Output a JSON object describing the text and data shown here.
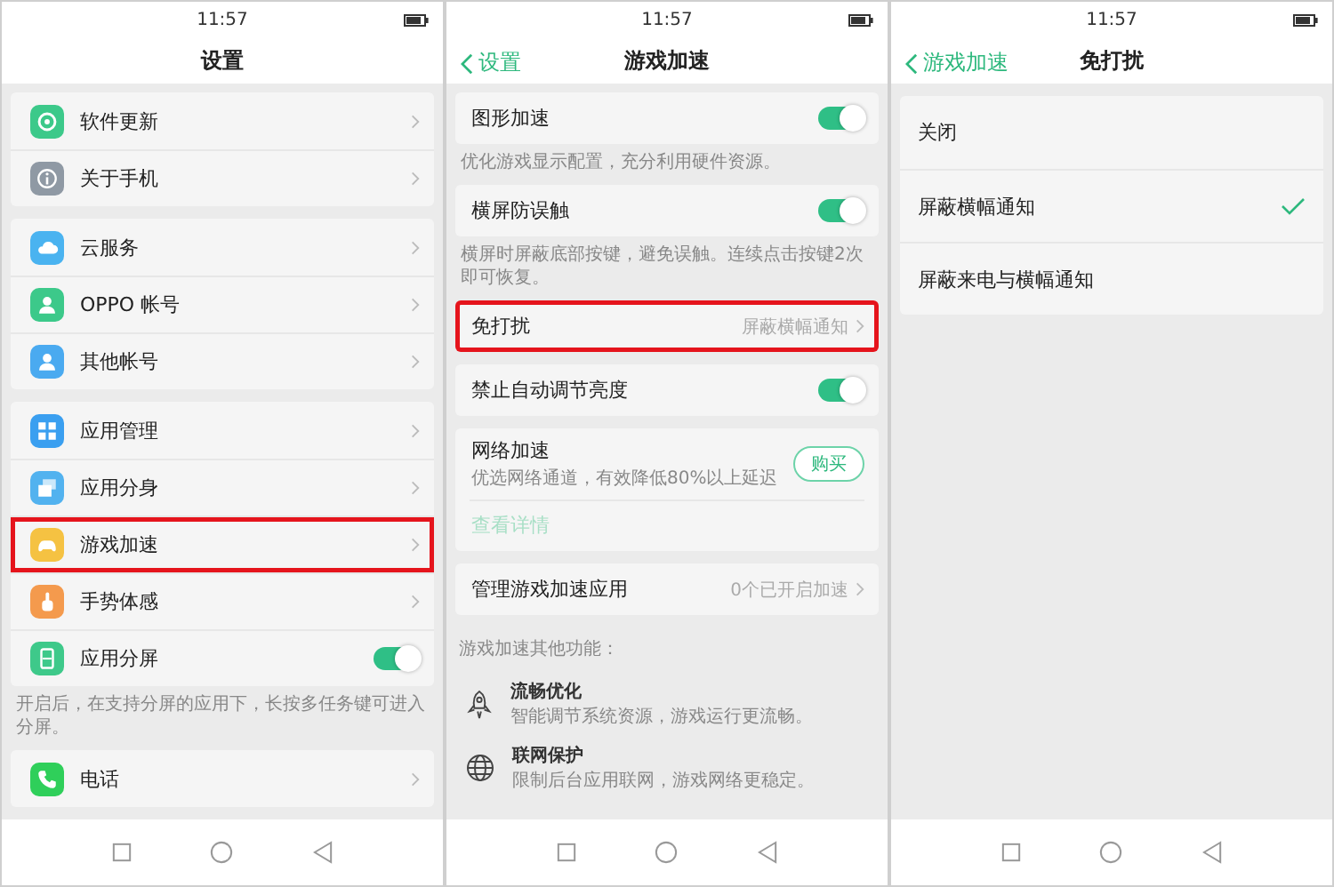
{
  "settings_screen": {
    "time": "11:57",
    "title": "设置",
    "groups": [
      {
        "items": [
          {
            "kind": "link",
            "label": "软件更新",
            "color": "#3cc98a",
            "highlighted": false
          },
          {
            "kind": "link",
            "label": "关于手机",
            "color": "#8f99a4",
            "highlighted": false
          }
        ]
      },
      {
        "items": [
          {
            "kind": "link",
            "label": "云服务",
            "color": "#4ab3f0",
            "highlighted": false
          },
          {
            "kind": "link",
            "label": "OPPO 帐号",
            "color": "#3cc98a",
            "highlighted": false
          },
          {
            "kind": "link",
            "label": "其他帐号",
            "color": "#4aaaf0",
            "highlighted": false
          }
        ]
      },
      {
        "items": [
          {
            "kind": "link",
            "label": "应用管理",
            "color": "#3a9ff0",
            "highlighted": false
          },
          {
            "kind": "link",
            "label": "应用分身",
            "color": "#52b2ef",
            "highlighted": false
          },
          {
            "kind": "link",
            "label": "游戏加速",
            "color": "#f5c242",
            "highlighted": true
          },
          {
            "kind": "link",
            "label": "手势体感",
            "color": "#f49a4d",
            "highlighted": false
          },
          {
            "kind": "toggle",
            "label": "应用分屏",
            "color": "#3ec98a",
            "on": true,
            "highlighted": false
          }
        ],
        "note": "开启后，在支持分屏的应用下，长按多任务键可进入分屏。"
      },
      {
        "items": [
          {
            "kind": "link",
            "label": "电话",
            "color": "#2fcf5a",
            "highlighted": false
          }
        ]
      }
    ]
  },
  "game_boost_screen": {
    "time": "11:57",
    "back": "设置",
    "title": "游戏加速",
    "cards": [
      {
        "kind": "toggle",
        "label": "图形加速",
        "on": true,
        "highlighted": false,
        "note": "优化游戏显示配置，充分利用硬件资源。"
      },
      {
        "kind": "toggle",
        "label": "横屏防误触",
        "on": true,
        "highlighted": false,
        "note": "横屏时屏蔽底部按键，避免误触。连续点击按键2次即可恢复。"
      },
      {
        "kind": "link",
        "label": "免打扰",
        "value": "屏蔽横幅通知",
        "highlighted": true
      },
      {
        "kind": "toggle",
        "label": "禁止自动调节亮度",
        "on": true,
        "highlighted": false
      },
      {
        "kind": "purchase",
        "label": "网络加速",
        "subtitle": "优选网络通道，有效降低80%以上延迟",
        "button": "购买",
        "link": "查看详情",
        "highlighted": false
      },
      {
        "kind": "link",
        "label": "管理游戏加速应用",
        "value": "0个已开启加速",
        "highlighted": false
      }
    ],
    "features_heading": "游戏加速其他功能：",
    "features": [
      {
        "title": "流畅优化",
        "subtitle": "智能调节系统资源，游戏运行更流畅。"
      },
      {
        "title": "联网保护",
        "subtitle": "限制后台应用联网，游戏网络更稳定。"
      }
    ]
  },
  "dnd_screen": {
    "time": "11:57",
    "back": "游戏加速",
    "title": "免打扰",
    "options": [
      {
        "label": "关闭",
        "selected": false
      },
      {
        "label": "屏蔽横幅通知",
        "selected": true
      },
      {
        "label": "屏蔽来电与横幅通知",
        "selected": false
      }
    ]
  }
}
